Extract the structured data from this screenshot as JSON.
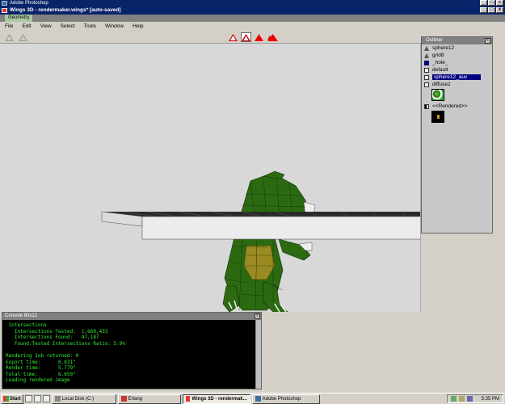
{
  "photoshop": {
    "title": "Adobe Photoshop"
  },
  "wings": {
    "title": "Wings 3D - rendermaker.wings* [auto-saved]"
  },
  "geometry": {
    "label": "Geometry"
  },
  "menu": [
    "File",
    "Edit",
    "View",
    "Select",
    "Tools",
    "Window",
    "Help"
  ],
  "window_controls": {
    "minimize": "_",
    "maximize": "□",
    "close": "x"
  },
  "outliner": {
    "title": "Outliner",
    "items": [
      {
        "label": "sphere12",
        "icon": "light-icon"
      },
      {
        "label": "grid8",
        "icon": "light-icon"
      },
      {
        "label": "_hole_",
        "icon": "material-icon"
      },
      {
        "label": "default",
        "icon": "material-icon"
      },
      {
        "label": "sphere12_auv",
        "icon": "material-icon"
      },
      {
        "label": "diffuse2",
        "icon": "image-icon"
      },
      {
        "label": "<<Rendered>>",
        "icon": "image-icon"
      }
    ]
  },
  "console": {
    "title": "Console 80x12",
    "lines": [
      " Intersections",
      "   Intersections Tested:  1,660,433",
      "   Intersections Found:   47,187",
      "   Found:Tested Intersections Ratio: 5.9%",
      "",
      "Rendering Job returned: 0",
      "Export time:      0.831\"",
      "Render time:      5.779\"",
      "Total time:       6.650\"",
      "Loading rendered image",
      "",
      "?"
    ]
  },
  "taskbar": {
    "start": "Start",
    "tasks": [
      {
        "label": "Local Disk (C:)",
        "active": false
      },
      {
        "label": "Erlang",
        "active": false
      },
      {
        "label": "Wings 3D - rendermak...",
        "active": true
      },
      {
        "label": "Adobe Photoshop",
        "active": false
      }
    ],
    "clock": "5:35 PM"
  },
  "colors": {
    "titlebar": "#0a246a",
    "console_text": "#33ee33",
    "selection": "#000080"
  }
}
